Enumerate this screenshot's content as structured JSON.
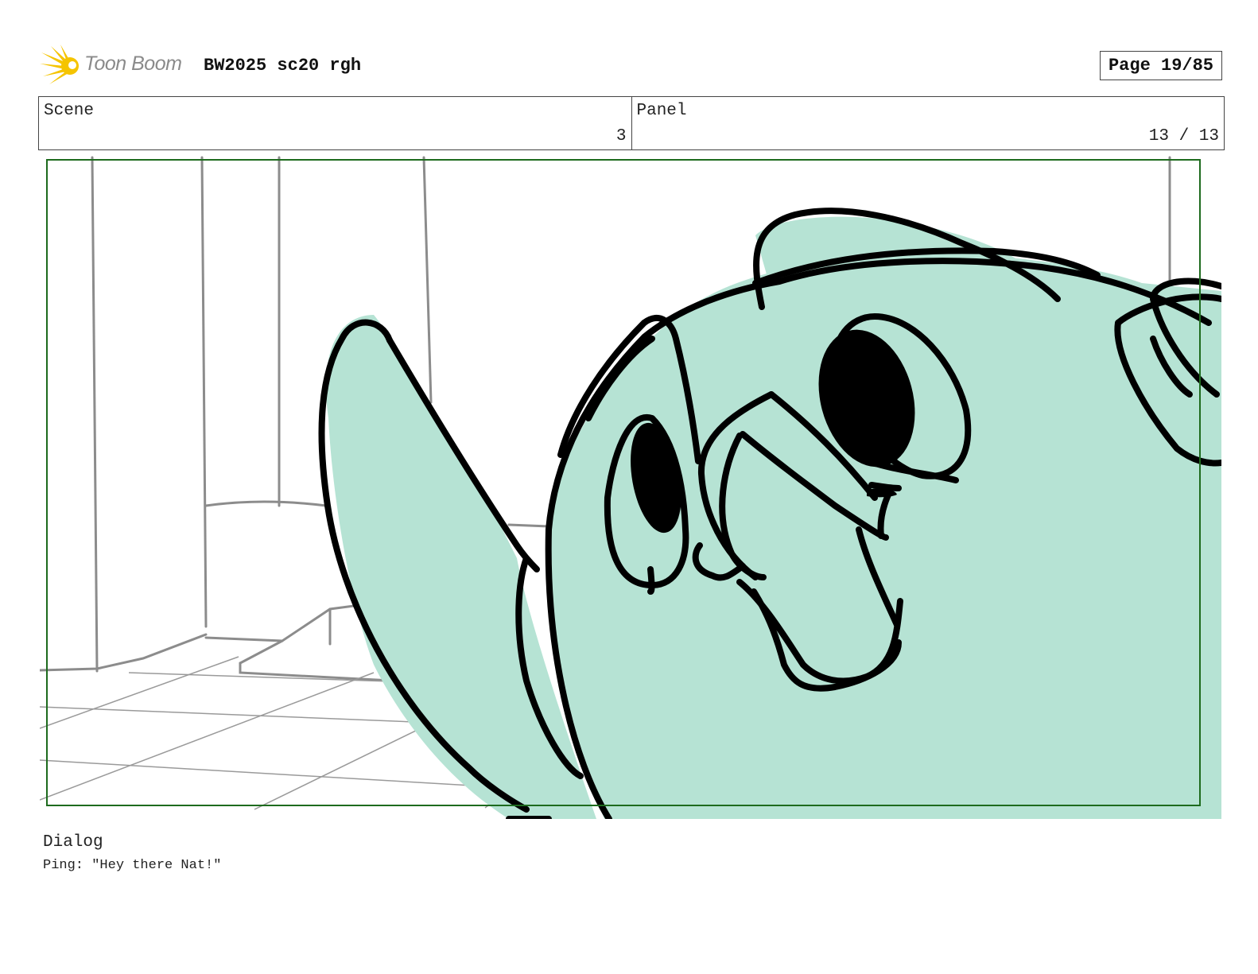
{
  "header": {
    "logo_text": "Toon Boom",
    "document_title": "BW2025 sc20 rgh",
    "page_label": "Page 19/85"
  },
  "info": {
    "scene_label": "Scene",
    "scene_value": "3",
    "panel_label": "Panel",
    "panel_value": "13 / 13"
  },
  "colors": {
    "frame_border": "#1e6b1e",
    "character_fill": "#b6e3d4",
    "line_art": "#000000",
    "background_lines": "#8c8c8c",
    "logo_burst": "#f5c400"
  },
  "dialog": {
    "label": "Dialog",
    "text": "Ping: \"Hey there Nat!\""
  }
}
